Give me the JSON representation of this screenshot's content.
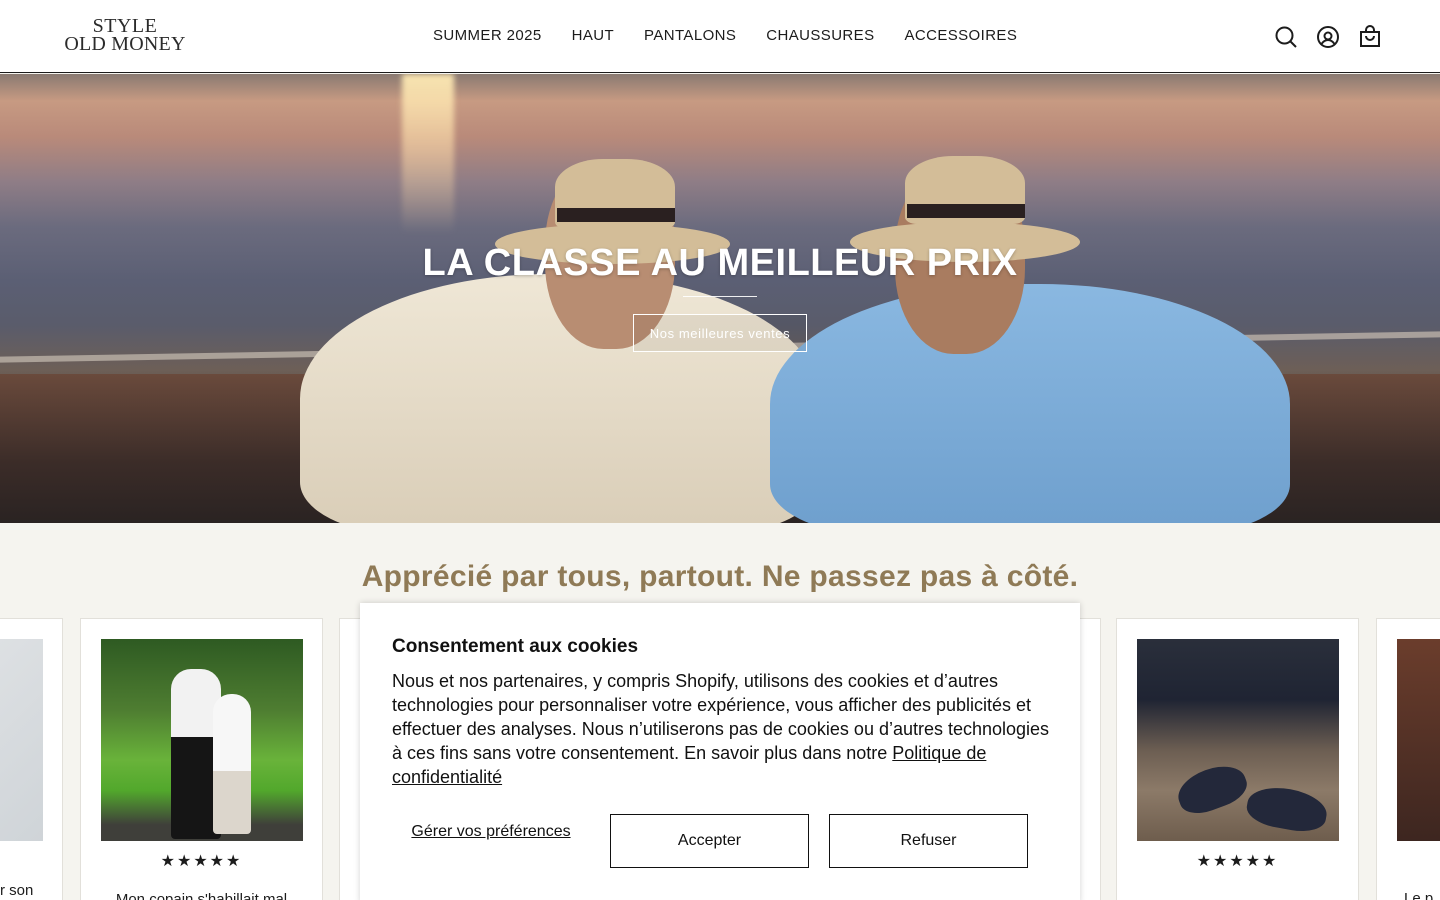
{
  "brand": {
    "line1": "STYLE",
    "line2": "OLD MONEY"
  },
  "nav": [
    {
      "label": "SUMMER 2025"
    },
    {
      "label": "HAUT"
    },
    {
      "label": "PANTALONS"
    },
    {
      "label": "CHAUSSURES"
    },
    {
      "label": "ACCESSOIRES"
    }
  ],
  "header_icons": [
    "search-icon",
    "account-icon",
    "cart-icon"
  ],
  "hero": {
    "title": "LA CLASSE AU MEILLEUR PRIX",
    "button": "Nos meilleures ventes"
  },
  "reviews": {
    "title": "Apprécié par tous, partout. Ne passez pas à côté.",
    "cards": [
      {
        "stars": "★★★★★",
        "text": "Mon copain s'habillait mal"
      },
      {
        "stars": "★★★★★",
        "text": ""
      }
    ],
    "partial_left": "r son",
    "partial_right": "Le p"
  },
  "cookie": {
    "title": "Consentement aux cookies",
    "body": "Nous et nos partenaires, y compris Shopify, utilisons des cookies et d’autres technologies pour personnaliser votre expérience, vous afficher des publicités et effectuer des analyses. Nous n’utiliserons pas de cookies ou d’autres technologies à ces fins sans votre consentement. En savoir plus dans notre",
    "link": "Politique de confidentialité",
    "manage": "Gérer vos préférences",
    "accept": "Accepter",
    "refuse": "Refuser"
  },
  "colors": {
    "accent_title": "#8f7a56",
    "background": "#f5f4ef",
    "header_border": "#1c1c1c"
  }
}
